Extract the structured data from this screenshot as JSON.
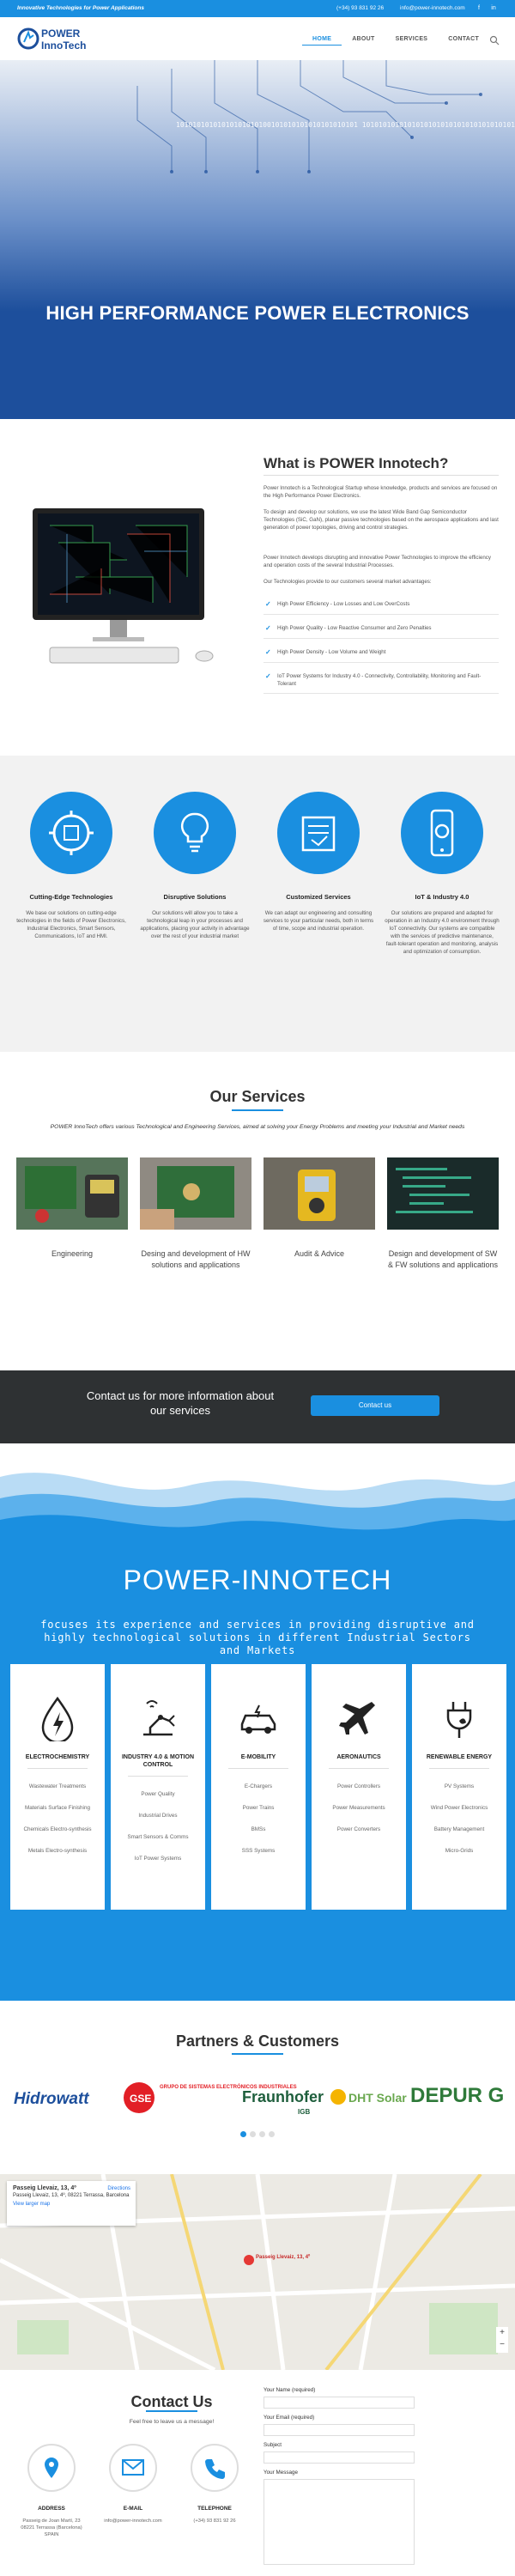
{
  "topbar": {
    "tagline": "Innovative Technologies for Power Applications",
    "phone": "(+34) 93 831 92 26",
    "email": "info@power-innotech.com"
  },
  "header": {
    "logo_text_1": "POWER",
    "logo_text_2": "InnoTech",
    "nav": [
      "HOME",
      "ABOUT",
      "SERVICES",
      "CONTACT"
    ]
  },
  "hero": {
    "binary": "10101010101010101010100101010101010101010101 10101010101010101010101010101010101010101010",
    "title": "HIGH PERFORMANCE POWER ELECTRONICS"
  },
  "about": {
    "title": "What is POWER Innotech?",
    "p1": "Power Innotech is a Technological Startup whose knowledge, products and services are focused on the High Performance Power Electronics.",
    "p2": "To design and develop our solutions, we use the latest Wide Band Gap Semiconductor Technologies (SiC, GaN), planar passive technologies based on the aerospace applications and last generation of power topologies, driving and control strategies.",
    "p3": "Power Innotech develops disrupting and innovative Power Technologies to improve the efficiency and operation costs of the several Industrial Processes.",
    "p4": "Our Technologies provide to our customers several market advantages:",
    "advantages": [
      "High Power Efficiency - Low Losses and Low OverCosts",
      "High Power Quality - Low Reactive Consumer and Zero Penalties",
      "High Power Density - Low Volume and Weight",
      "IoT Power Systems for Industry 4.0 - Connectivity, Controllability, Monitoring and Fault-Tolerant"
    ]
  },
  "features": [
    {
      "title": "Cutting-Edge Technologies",
      "text": "We base our solutions on cutting-edge technologies in the fields of Power Electronics, Industrial Electronics, Smart Sensors, Communications, IoT and HMI."
    },
    {
      "title": "Disruptive Solutions",
      "text": "Our solutions will allow you to take a technological leap in your processes and applications, placing your activity in advantage over the rest of your industrial market"
    },
    {
      "title": "Customized Services",
      "text": "We can adapt our engineering and consulting services to your particular needs, both in terms of time, scope and industrial operation."
    },
    {
      "title": "IoT & Industry 4.0",
      "text": "Our solutions are prepared and adapted for operation in an Industry 4.0 environment through IoT connectivity. Our systems are compatible with the services of predictive maintenance, fault-tolerant operation and monitoring, analysis and optimization of consumption."
    }
  ],
  "services": {
    "title": "Our Services",
    "intro": "POWER InnoTech offers various Technological and Engineering Services, aimed at solving your Energy Problems and meeting your Industrial and Market needs",
    "items": [
      "Engineering",
      "Desing and development of HW solutions and applications",
      "Audit & Advice",
      "Design and development of SW & FW solutions and applications"
    ]
  },
  "cta": {
    "text": "Contact us for more information about our services",
    "button": "Contact us"
  },
  "sectors": {
    "title": "POWER-INNOTECH",
    "subtitle": "focuses its experience and services in providing disruptive and highly technological solutions in different Industrial Sectors and Markets",
    "cards": [
      {
        "title": "ELECTROCHEMISTRY",
        "items": [
          "Wastewater Treatments",
          "Materials Surface Finishing",
          "Chemicals Electro-synthesis",
          "Metals Electro-synthesis"
        ]
      },
      {
        "title": "INDUSTRY 4.0 & MOTION CONTROL",
        "items": [
          "Power Quality",
          "Industrial Drives",
          "Smart Sensors & Comms",
          "IoT Power Systems"
        ]
      },
      {
        "title": "E-MOBILITY",
        "items": [
          "E-Chargers",
          "Power Trains",
          "BMSs",
          "SSS Systems"
        ]
      },
      {
        "title": "AERONAUTICS",
        "items": [
          "Power Controllers",
          "Power Measurements",
          "Power Converters"
        ]
      },
      {
        "title": "RENEWABLE ENERGY",
        "items": [
          "PV Systems",
          "Wind Power Electronics",
          "Battery Management",
          "Micro-Grids"
        ]
      }
    ]
  },
  "partners": {
    "title": "Partners & Customers",
    "logos": [
      "Hidrowatt",
      "GSE",
      "GRUPO DE SISTEMAS ELECTRÓNICOS INDUSTRIALES",
      "Fraunhofer",
      "IGB",
      "DHT Solar",
      "DEPUR GAN"
    ]
  },
  "map": {
    "place": "Passeig Llevaiz, 13, 4º",
    "address": "Passeig Llevaiz, 13, 4º, 08221 Terrassa, Barcelona",
    "directions": "Directions",
    "view_larger": "View larger map",
    "pin_label": "Passeig Llevaiz, 13, 4º"
  },
  "contact": {
    "title": "Contact Us",
    "subtitle": "Feel free to leave us a message!",
    "address_title": "ADDRESS",
    "address_text": "Passeig de Joan Martí, 23 08221 Terrassa (Barcelona) SPAIN",
    "email_title": "E-MAIL",
    "email_text": "info@power-innotech.com",
    "phone_title": "TELEPHONE",
    "phone_text": "(+34) 93 831 92 26",
    "form": {
      "name_label": "Your Name (required)",
      "email_label": "Your Email (required)",
      "subject_label": "Subject",
      "message_label": "Your Message"
    }
  }
}
